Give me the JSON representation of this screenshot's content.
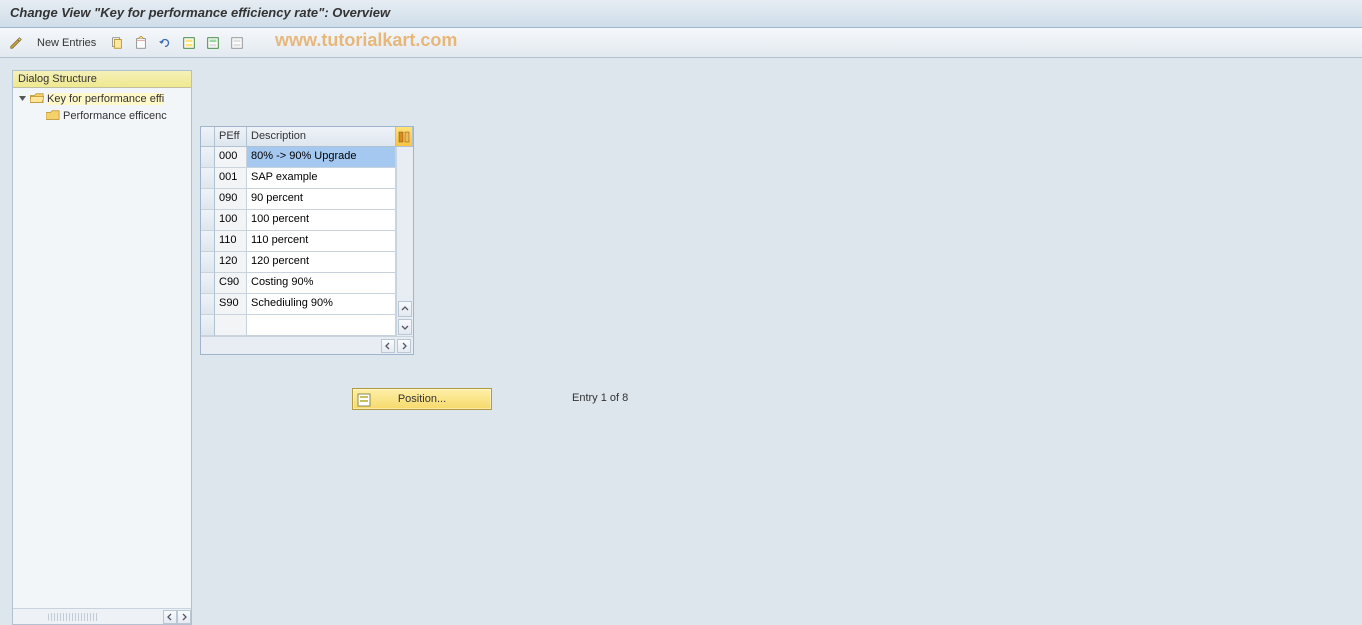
{
  "title": "Change View \"Key for performance efficiency rate\": Overview",
  "toolbar": {
    "new_entries": "New Entries"
  },
  "watermark": "www.tutorialkart.com",
  "sidebar": {
    "header": "Dialog Structure",
    "items": [
      {
        "label": "Key for performance effi",
        "open": true,
        "level": 0,
        "selected": true
      },
      {
        "label": "Performance efficenc",
        "open": false,
        "level": 1,
        "selected": false
      }
    ]
  },
  "grid": {
    "columns": {
      "c1": "PEff",
      "c2": "Description"
    },
    "rows": [
      {
        "peff": "000",
        "desc": "80% -> 90% Upgrade",
        "selected": true
      },
      {
        "peff": "001",
        "desc": "SAP example",
        "selected": false
      },
      {
        "peff": "090",
        "desc": "90 percent",
        "selected": false
      },
      {
        "peff": "100",
        "desc": "100 percent",
        "selected": false
      },
      {
        "peff": "110",
        "desc": "110 percent",
        "selected": false
      },
      {
        "peff": "120",
        "desc": "120 percent",
        "selected": false
      },
      {
        "peff": "C90",
        "desc": "Costing 90%",
        "selected": false
      },
      {
        "peff": "S90",
        "desc": "Schediuling 90%",
        "selected": false
      },
      {
        "peff": "",
        "desc": "",
        "selected": false
      }
    ]
  },
  "position_button": "Position...",
  "entry_status": "Entry 1 of 8"
}
